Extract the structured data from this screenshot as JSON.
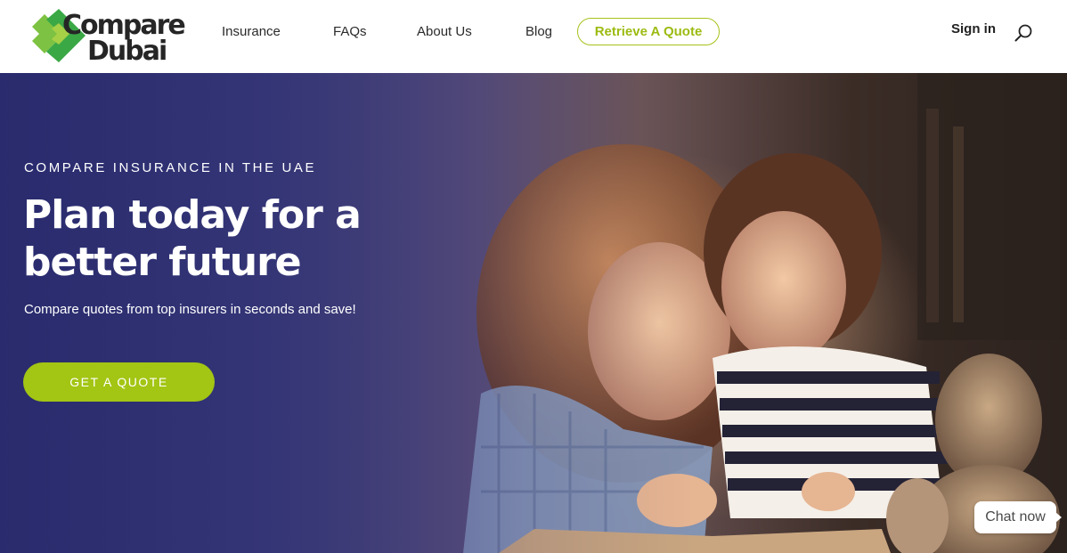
{
  "brand": {
    "logo_line1": "Compare",
    "logo_line2": "Dubai",
    "accent_color": "#a3c514",
    "logo_dark": "#262626"
  },
  "nav": {
    "items": [
      {
        "label": "Insurance"
      },
      {
        "label": "FAQs"
      },
      {
        "label": "About Us"
      },
      {
        "label": "Blog"
      }
    ],
    "retrieve_quote_label": "Retrieve A Quote",
    "signin_label": "Sign in",
    "search_icon": "search-icon"
  },
  "hero": {
    "eyebrow": "COMPARE INSURANCE IN THE UAE",
    "headline": "Plan today for a better future",
    "subline": "Compare quotes from top insurers in seconds and save!",
    "cta_label": "GET A QUOTE"
  },
  "chat": {
    "label": "Chat now"
  }
}
